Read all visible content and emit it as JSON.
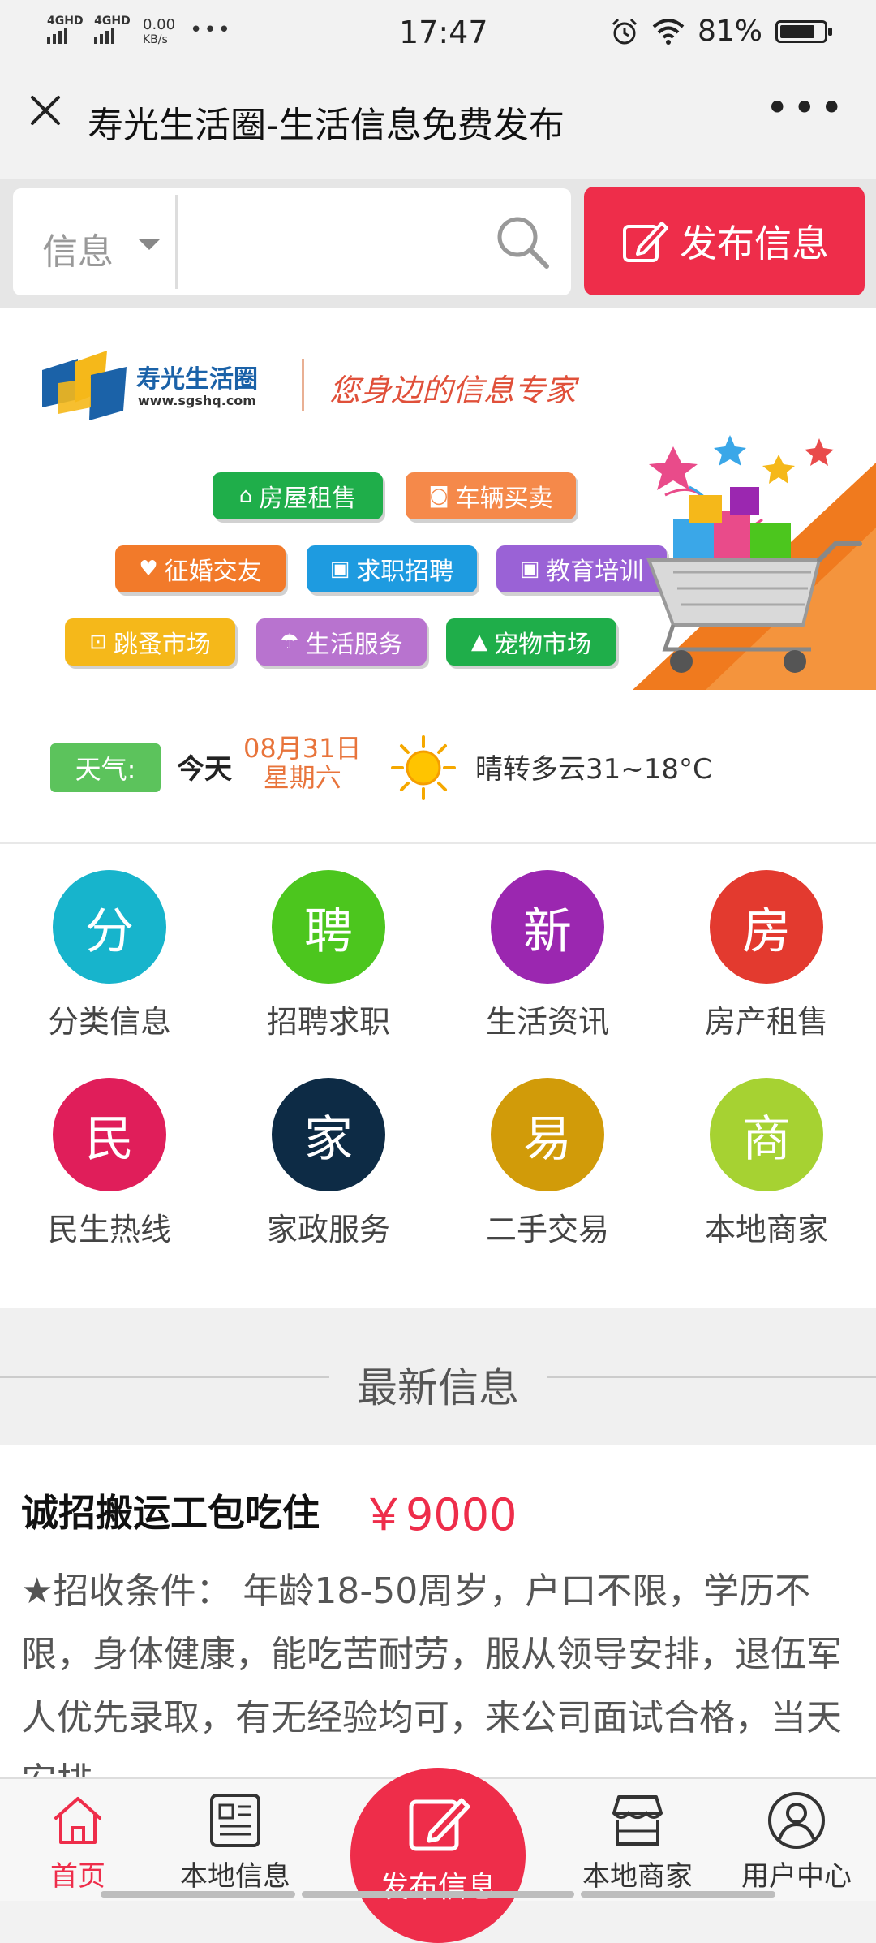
{
  "status_bar": {
    "network1": "4GHD",
    "network2": "4GHD",
    "speed_value": "0.00",
    "speed_unit": "KB/s",
    "time": "17:47",
    "battery_text": "81%",
    "battery_level": 0.81
  },
  "title_bar": {
    "title": "寿光生活圈-生活信息免费发布"
  },
  "search": {
    "category": "信息",
    "placeholder": "",
    "publish_label": "发布信息"
  },
  "banner": {
    "logo_name": "寿光生活圈",
    "logo_url": "www.sgshq.com",
    "slogan": "您身边的信息专家",
    "tags": [
      {
        "label": "房屋租售",
        "icon": "house-icon",
        "color": "#1fae4a"
      },
      {
        "label": "车辆买卖",
        "icon": "car-icon",
        "color": "#f5894a"
      },
      {
        "label": "征婚交友",
        "icon": "heart-icon",
        "color": "#f27a2a"
      },
      {
        "label": "求职招聘",
        "icon": "briefcase-icon",
        "color": "#1e9be0"
      },
      {
        "label": "教育培训",
        "icon": "briefcase-icon",
        "color": "#9a62d6"
      },
      {
        "label": "跳蚤市场",
        "icon": "cart-icon",
        "color": "#f5b81a"
      },
      {
        "label": "生活服务",
        "icon": "umbrella-icon",
        "color": "#b873cf"
      },
      {
        "label": "宠物市场",
        "icon": "paw-icon",
        "color": "#1fae4a"
      }
    ]
  },
  "weather": {
    "label": "天气:",
    "today": "今天",
    "date": "08月31日",
    "weekday": "星期六",
    "icon": "sun-icon",
    "description": "晴转多云31~18°C"
  },
  "categories": [
    {
      "char": "分",
      "label": "分类信息",
      "color": "#17b4cc"
    },
    {
      "char": "聘",
      "label": "招聘求职",
      "color": "#4cc61e"
    },
    {
      "char": "新",
      "label": "生活资讯",
      "color": "#9b27b0"
    },
    {
      "char": "房",
      "label": "房产租售",
      "color": "#e33a2f"
    },
    {
      "char": "民",
      "label": "民生热线",
      "color": "#e01e5a"
    },
    {
      "char": "家",
      "label": "家政服务",
      "color": "#0d2b45"
    },
    {
      "char": "易",
      "label": "二手交易",
      "color": "#d19b09"
    },
    {
      "char": "商",
      "label": "本地商家",
      "color": "#a6d232"
    }
  ],
  "latest": {
    "section_title": "最新信息",
    "items": [
      {
        "title": "诚招搬运工包吃住",
        "price": "￥9000",
        "description": "★招收条件： 年龄18-50周岁，户口不限，学历不限，身体健康，能吃苦耐劳，服从领导安排，退伍军人优先录取，有无经验均可，来公司面试合格，当天安排..."
      }
    ]
  },
  "bottom_nav": {
    "home": "首页",
    "local_info": "本地信息",
    "publish": "发布信息",
    "merchants": "本地商家",
    "user_center": "用户中心"
  }
}
